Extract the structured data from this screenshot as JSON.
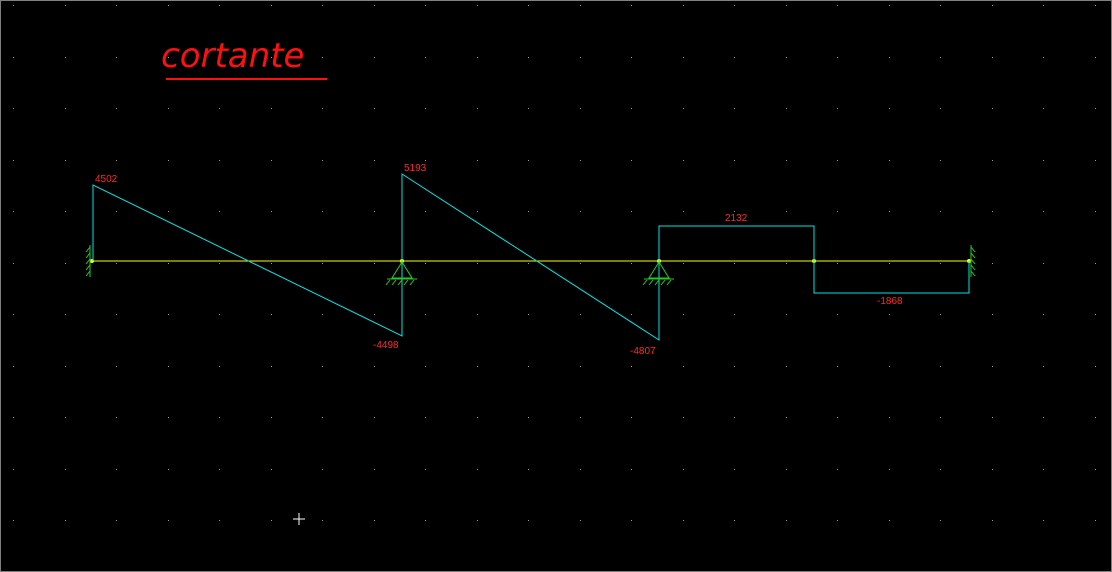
{
  "title": "cortante",
  "colors": {
    "background": "#000000",
    "grid_dots": "#9a9a9a",
    "beam": "#ffff00",
    "shear": "#00e5e5",
    "labels": "#ff2a2a",
    "supports": "#22cc22",
    "title": "#ff1010"
  },
  "labels": {
    "left_start": "4502",
    "span1_end": "-4498",
    "span2_start": "5193",
    "span2_end": "-4807",
    "span3": "2132",
    "span4": "-1868"
  },
  "supports": [
    "fixed-left",
    "pin",
    "pin",
    "fixed-right"
  ],
  "cursor": "crosshair-icon"
}
